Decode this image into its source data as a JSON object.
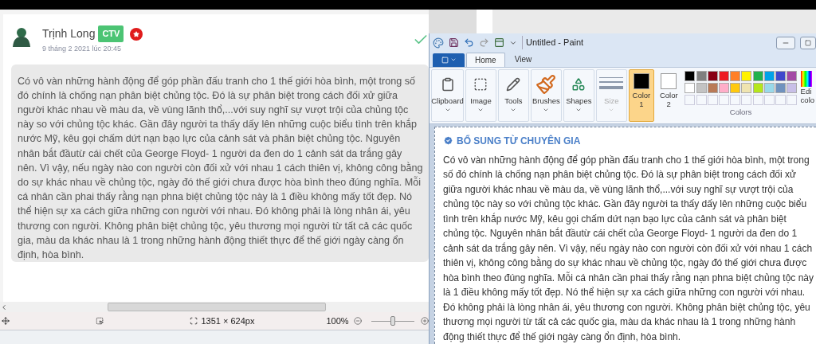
{
  "comment": {
    "author": "Trịnh Long",
    "badge": "CTV",
    "timestamp": "9 tháng 2 2021 lúc 20:45",
    "verified": true,
    "body": "Có vô vàn những hành động để góp phần đấu tranh cho 1 thế giới hòa bình, một trong số đó chính là chống nạn phân biệt chủng tộc. Đó là sự phân biệt trong cách đối xử giữa người khác nhau về màu da, về vùng lãnh thổ,...với suy nghĩ sự vượt trội của chủng tộc này so với chủng tộc khác. Gần đây người ta thấy dấy lên những cuộc biểu tình trên khắp nước Mỹ, kêu gọi chấm dứt nạn bạo lực của cảnh sát và phân biệt chủng tộc. Nguyên nhân bắt đầutừ cái chết của George Floyd- 1 người da đen do 1 cảnh sát da trắng gây nên. Vì vậy, nếu ngày nào con người còn đối xử với nhau 1 cách thiên vị, không công bằng do sự khác nhau về chủng tộc, ngày đó thế giới chưa được hòa bình theo đúng nghĩa. Mỗi cá nhân cần phai thấy rằng nạn phna biệt chủng tộc này là 1 điều không mấy tốt đẹp. Nó thể hiện sự xa cách giữa những con người với nhau. Đó không phải là lòng nhân ái, yêu thương con người. Không phân biệt chủng tộc, yêu thương mọi người từ tất cả các quốc gia, màu da khác nhau là 1 trong những hành động thiết thực để thế giới ngày càng ổn định, hòa bình."
  },
  "status_bar": {
    "canvas_size": "1351 × 624px",
    "zoom": "100%",
    "zoom_slider": {
      "level": 0.5
    }
  },
  "paint": {
    "title": "Untitled - Paint",
    "tabs": [
      {
        "label": "Home",
        "selected": true
      },
      {
        "label": "View",
        "selected": false
      }
    ],
    "groups": [
      {
        "kind": "clipboard",
        "label": "Clipboard",
        "disabled": false
      },
      {
        "kind": "image",
        "label": "Image",
        "disabled": false
      },
      {
        "kind": "tools",
        "label": "Tools",
        "disabled": false
      },
      {
        "kind": "brushes",
        "label": "Brushes",
        "disabled": false
      },
      {
        "kind": "shapes",
        "label": "Shapes",
        "disabled": false
      },
      {
        "kind": "size",
        "label": "Size",
        "disabled": true
      }
    ],
    "color_slots": [
      {
        "label": "Color",
        "number": "1",
        "color": "#000000",
        "selected": true
      },
      {
        "label": "Color",
        "number": "2",
        "color": "#ffffff",
        "selected": false
      }
    ],
    "palette": [
      {
        "color": "#000000"
      },
      {
        "color": "#7f7f7f"
      },
      {
        "color": "#880015"
      },
      {
        "color": "#ed1c24"
      },
      {
        "color": "#ff7f27"
      },
      {
        "color": "#fff200"
      },
      {
        "color": "#22b14c"
      },
      {
        "color": "#00a2e8"
      },
      {
        "color": "#3f48cc"
      },
      {
        "color": "#a349a4"
      },
      {
        "color": "#ffffff"
      },
      {
        "color": "#c3c3c3"
      },
      {
        "color": "#b97a57"
      },
      {
        "color": "#ffaec9"
      },
      {
        "color": "#ffc90e"
      },
      {
        "color": "#efe4b0"
      },
      {
        "color": "#b5e61d"
      },
      {
        "color": "#99d9ea"
      },
      {
        "color": "#7092be"
      },
      {
        "color": "#c8bfe7"
      }
    ],
    "colors_label": "Colors",
    "edit_colors": [
      "Edi",
      "colo"
    ],
    "expert": {
      "heading": "BỔ SUNG TỪ CHUYÊN GIA",
      "body": "Có vô vàn những hành động để góp phần đấu tranh cho 1 thế giới hòa bình, một trong số đó chính là chống nạn phân biệt chủng tộc. Đó là sự phân biệt trong cách đối xử giữa người khác nhau về màu da, về vùng lãnh thổ,...với suy nghĩ sự vượt trội của chủng tộc này so với chủng tộc khác. Gần đây người ta thấy dấy lên những cuộc biểu tình trên khắp nước Mỹ, kêu gọi chấm dứt nạn bạo lực của cảnh sát và phân biệt chủng tộc. Nguyên nhân bắt đầutừ cái chết của George Floyd- 1 người da đen do 1 cảnh sát da trắng gây nên. Vì vậy, nếu ngày nào con người còn đối xử với nhau 1 cách thiên vị, không công bằng do sự khác nhau về chủng tộc, ngày đó thế giới chưa được hòa bình theo đúng nghĩa. Mỗi cá nhân cần phai thấy rằng nạn phna biệt chủng tộc này là 1 điều không mấy tốt đẹp. Nó thể hiện sự xa cách giữa những con người với nhau. Đó không phải là lòng nhân ái, yêu thương con người. Không phân biệt chủng tộc, yêu thương mọi người từ tất cả các quốc gia, màu da khác nhau là 1 trong những hành động thiết thực để thế giới ngày càng ổn định, hòa bình."
    }
  }
}
